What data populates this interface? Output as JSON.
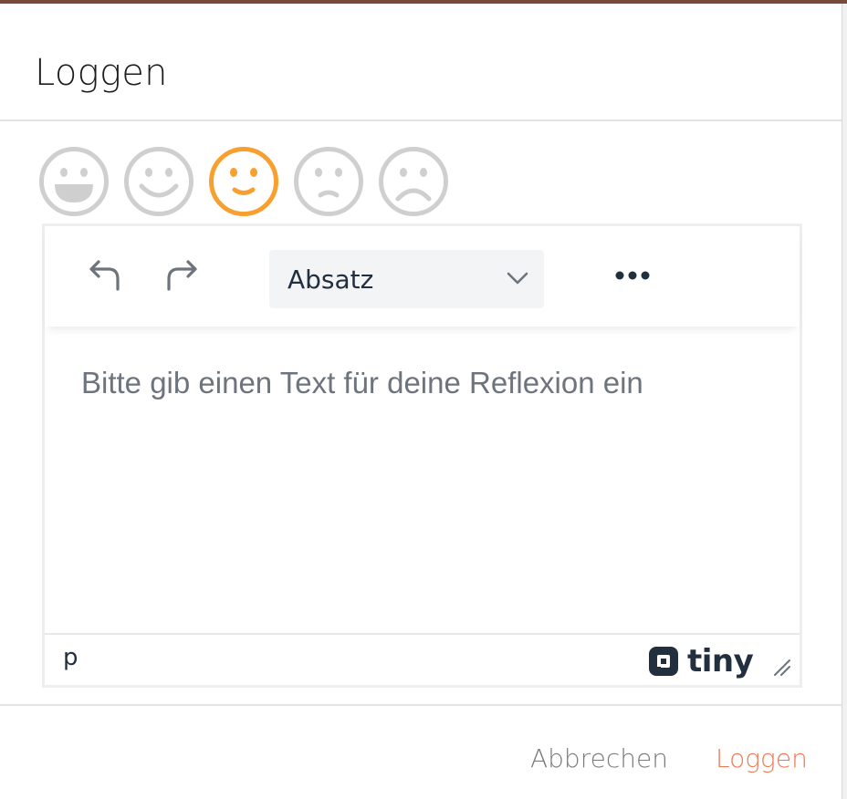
{
  "dialog": {
    "title": "Loggen"
  },
  "moods": {
    "selected_index": 2,
    "items": [
      {
        "icon": "laughing-face-icon"
      },
      {
        "icon": "smiling-face-icon"
      },
      {
        "icon": "slightly-smiling-face-icon"
      },
      {
        "icon": "slightly-frowning-face-icon"
      },
      {
        "icon": "frowning-face-icon"
      }
    ],
    "colors": {
      "inactive": "#cfcfcf",
      "selected": "#f7a030"
    }
  },
  "editor": {
    "toolbar": {
      "undo_icon": "undo-icon",
      "redo_icon": "redo-icon",
      "block_format": "Absatz",
      "more_icon": "more-horizontal-icon"
    },
    "placeholder": "Bitte gib einen Text für deine Reflexion ein",
    "statusbar": {
      "path": "p",
      "brand": "tiny"
    }
  },
  "footer": {
    "cancel_label": "Abbrechen",
    "confirm_label": "Loggen"
  },
  "colors": {
    "accent": "#ef7a57",
    "text_dark": "#222f3e",
    "placeholder": "#6d747e"
  }
}
